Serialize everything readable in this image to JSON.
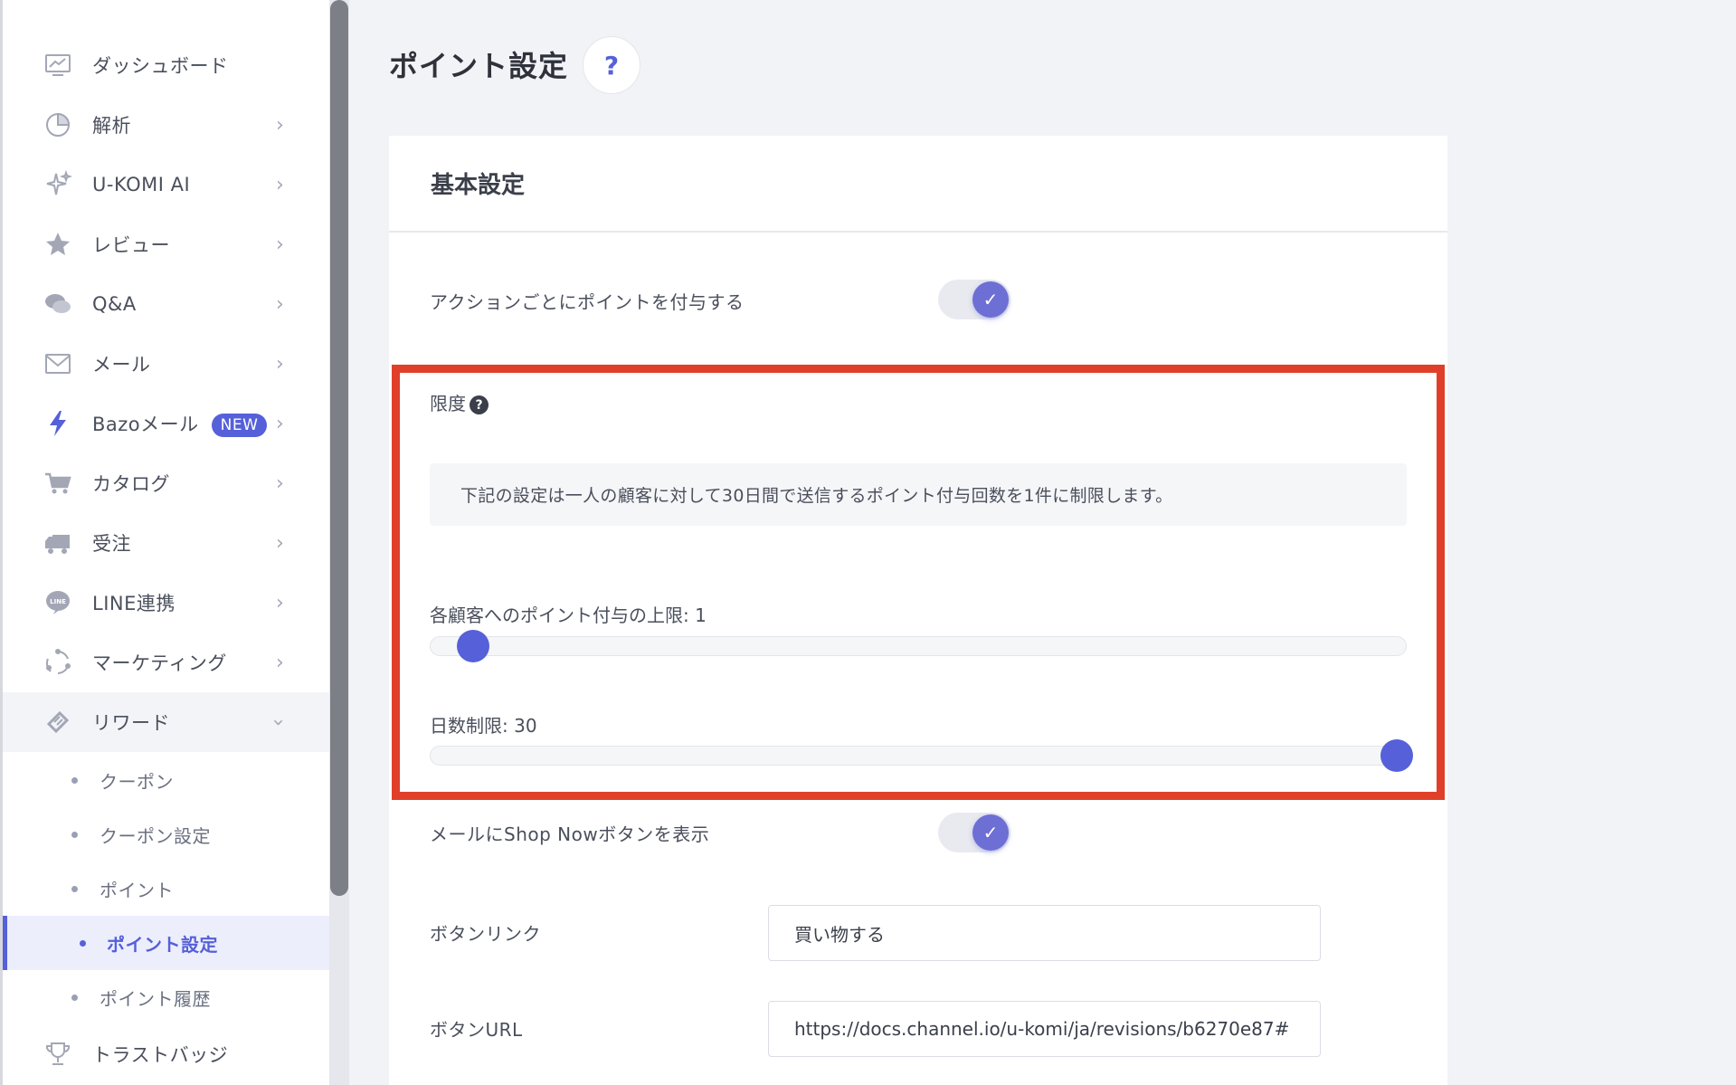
{
  "sidebar": {
    "items": [
      {
        "label": "ダッシュボード",
        "icon": "dashboard-chart-icon"
      },
      {
        "label": "解析",
        "icon": "analytics-icon"
      },
      {
        "label": "U-KOMI AI",
        "icon": "sparkle-icon"
      },
      {
        "label": "レビュー",
        "icon": "star-icon"
      },
      {
        "label": "Q&A",
        "icon": "chat-bubbles-icon"
      },
      {
        "label": "メール",
        "icon": "mail-icon"
      },
      {
        "label": "Bazoメール",
        "icon": "lightning-icon",
        "badge": "NEW"
      },
      {
        "label": "カタログ",
        "icon": "cart-icon"
      },
      {
        "label": "受注",
        "icon": "truck-icon"
      },
      {
        "label": "LINE連携",
        "icon": "line-icon"
      },
      {
        "label": "マーケティング",
        "icon": "marketing-cycle-icon"
      },
      {
        "label": "リワード",
        "icon": "ticket-icon"
      }
    ],
    "sub_items": [
      {
        "label": "クーポン"
      },
      {
        "label": "クーポン設定"
      },
      {
        "label": "ポイント"
      },
      {
        "label": "ポイント設定",
        "active": true
      },
      {
        "label": "ポイント履歴"
      }
    ],
    "bottom_item": {
      "label": "トラストバッジ",
      "icon": "trophy-icon"
    }
  },
  "page": {
    "title": "ポイント設定",
    "help_symbol": "?"
  },
  "card": {
    "title": "基本設定",
    "action_points_label": "アクションごとにポイントを付与する",
    "action_points_enabled": true,
    "limit": {
      "title": "限度",
      "help_symbol": "?",
      "info": "下記の設定は一人の顧客に対して30日間で送信するポイント付与回数を1件に制限します。",
      "per_customer_label": "各顧客へのポイント付与の上限: 1",
      "per_customer_value": 1,
      "days_label": "日数制限: 30",
      "days_value": 30
    },
    "shop_now_label": "メールにShop Nowボタンを表示",
    "shop_now_enabled": true,
    "button_link_label": "ボタンリンク",
    "button_link_value": "買い物する",
    "button_url_label": "ボタンURL",
    "button_url_value": "https://docs.channel.io/u-komi/ja/revisions/b6270e87#"
  },
  "colors": {
    "accent": "#5560d9",
    "highlight_border": "#e0402a",
    "toggle_knob": "#6e6fd4"
  }
}
